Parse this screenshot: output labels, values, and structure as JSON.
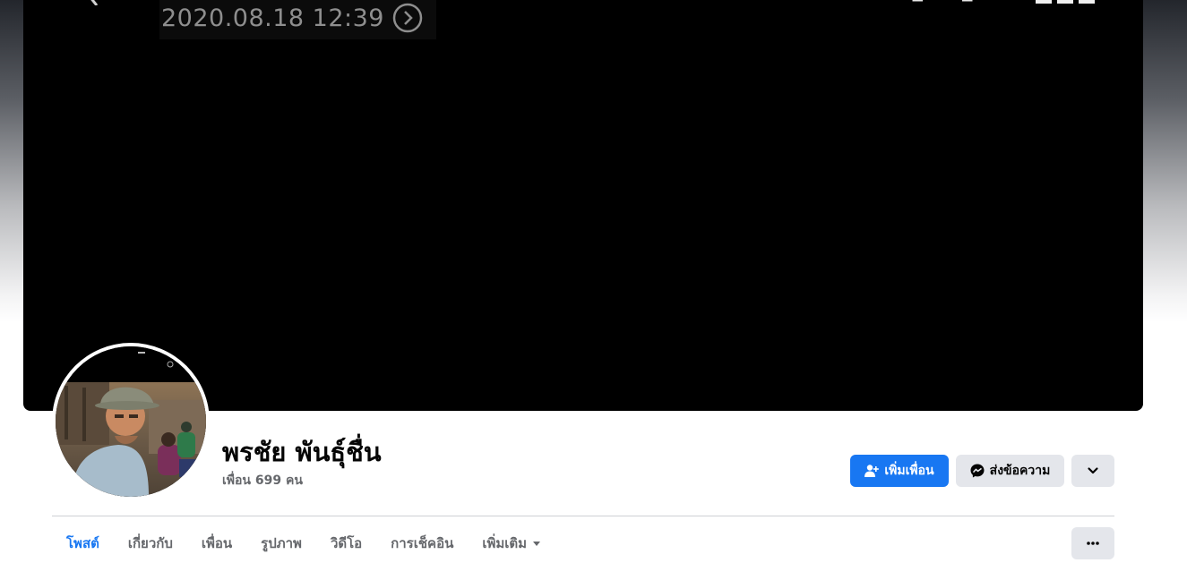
{
  "cover": {
    "timestamp": "2020.08.18 12:39",
    "icons": [
      "back-chevron-icon",
      "forward-circle-icon",
      "fullscreen-icon",
      "grid-icon"
    ]
  },
  "profile": {
    "name": "พรชัย พันธุ์ชื่น",
    "friends": "เพื่อน 699 คน"
  },
  "actions": {
    "add_friend": "เพิ่มเพื่อน",
    "message": "ส่งข้อความ",
    "more_icon": "chevron-down-icon"
  },
  "tabs": [
    {
      "label": "โพสต์",
      "active": true
    },
    {
      "label": "เกี่ยวกับ",
      "active": false
    },
    {
      "label": "เพื่อน",
      "active": false
    },
    {
      "label": "รูปภาพ",
      "active": false
    },
    {
      "label": "วิดีโอ",
      "active": false
    },
    {
      "label": "การเช็คอิน",
      "active": false
    },
    {
      "label": "เพิ่มเติม",
      "active": false
    }
  ],
  "colors": {
    "accent": "#1877f2",
    "secondary_button": "#e4e6eb",
    "muted_text": "#65676b"
  }
}
